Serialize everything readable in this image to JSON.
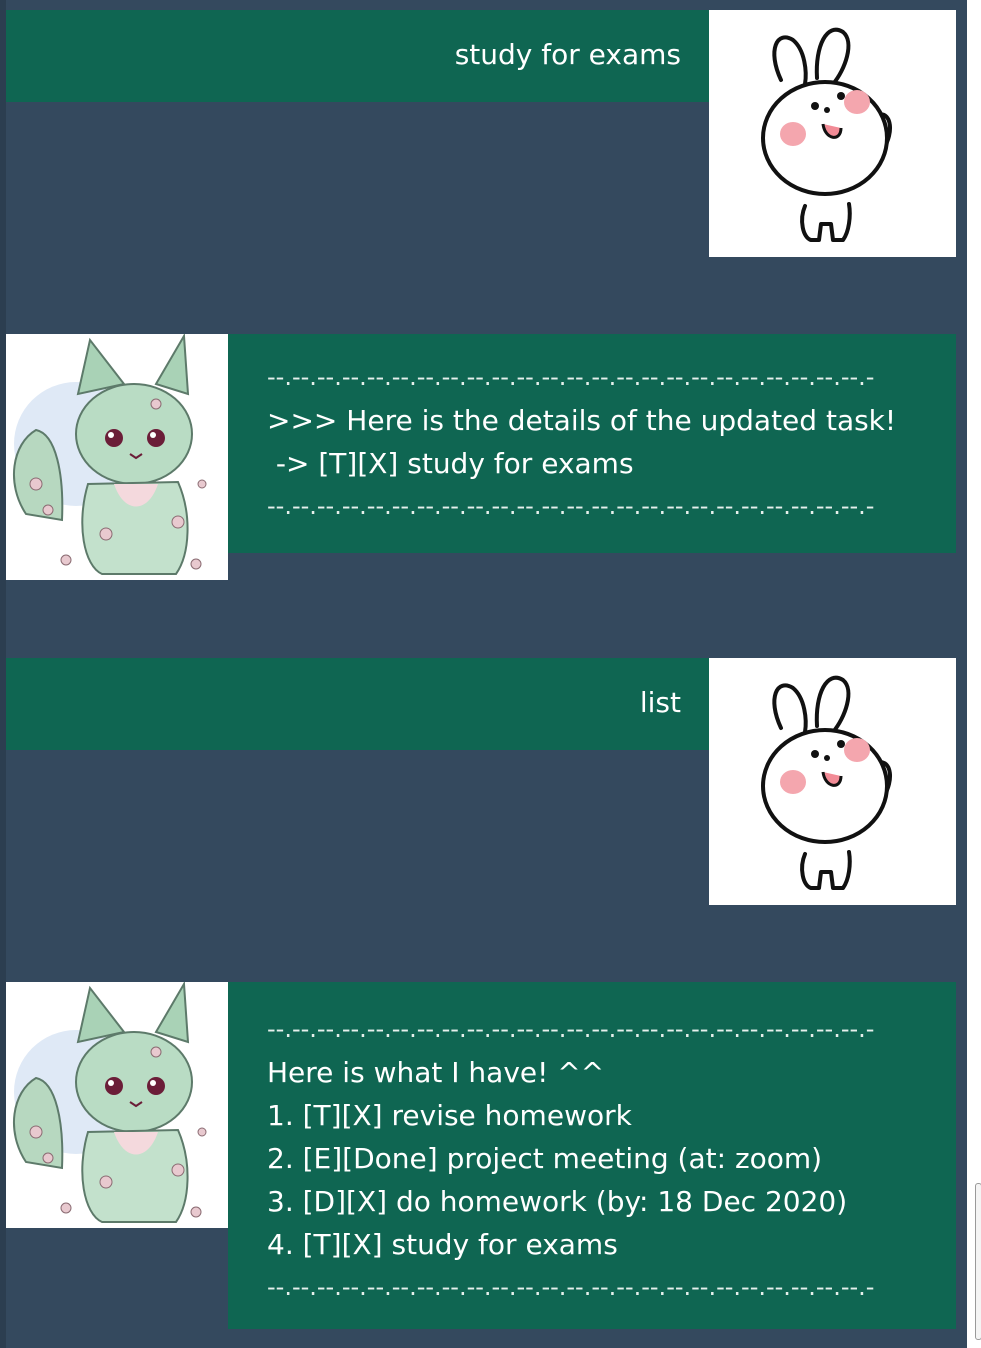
{
  "conversation": {
    "msg1": {
      "text": "study for exams"
    },
    "reply1": {
      "separator": "--.--.--.--.--.--.--.--.--.--.--.--.--.--.--.--.--.--.--.--.--.--.--.--.-",
      "line1": ">>> Here is the details of the updated task!",
      "line2": " -> [T][X] study for exams"
    },
    "msg2": {
      "text": "list"
    },
    "reply2": {
      "separator": "--.--.--.--.--.--.--.--.--.--.--.--.--.--.--.--.--.--.--.--.--.--.--.--.-",
      "header": "Here is what I have! ^^",
      "items": [
        "1. [T][X] revise homework",
        "2. [E][Done] project meeting (at: zoom)",
        "3. [D][X] do homework (by: 18 Dec 2020)",
        "4. [T][X] study for exams"
      ]
    }
  },
  "avatars": {
    "user": "bunny-icon",
    "bot": "green-fox-icon"
  },
  "colors": {
    "background": "#34495e",
    "bubble": "#0f6652",
    "text": "#ffffff"
  }
}
